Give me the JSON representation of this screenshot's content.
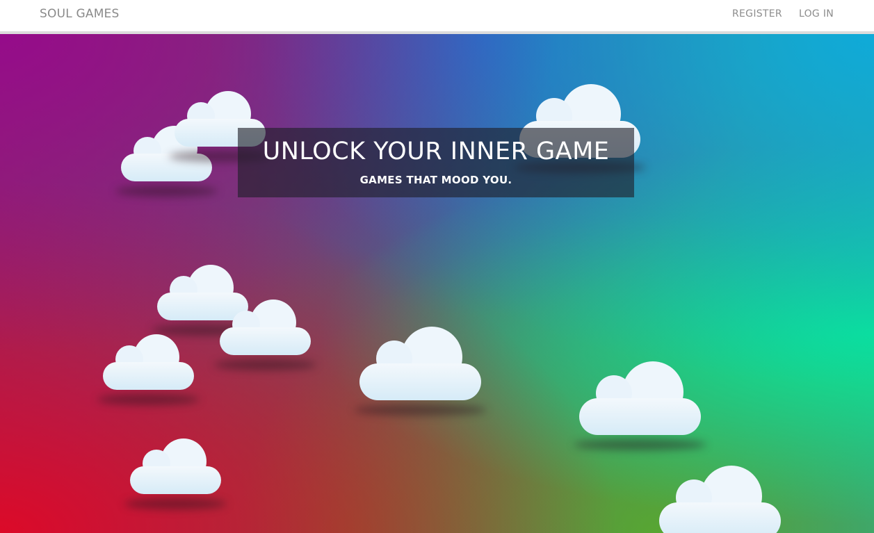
{
  "navbar": {
    "brand": "SOUL GAMES",
    "links": [
      "REGISTER",
      "LOG IN"
    ]
  },
  "hero": {
    "title": "UNLOCK YOUR INNER GAME",
    "subtitle": "GAMES THAT MOOD YOU."
  },
  "colors": {
    "navbar_bg": "#ffffff",
    "nav_text": "#8a8a8a",
    "gradient_top_left": "#960a8c",
    "gradient_top_right": "#0eaadc",
    "gradient_bottom_left": "#dc0a28",
    "gradient_right": "#0ae696",
    "banner_bg": "rgba(30,30,40,0.62)",
    "cloud": "#eef6fc"
  }
}
